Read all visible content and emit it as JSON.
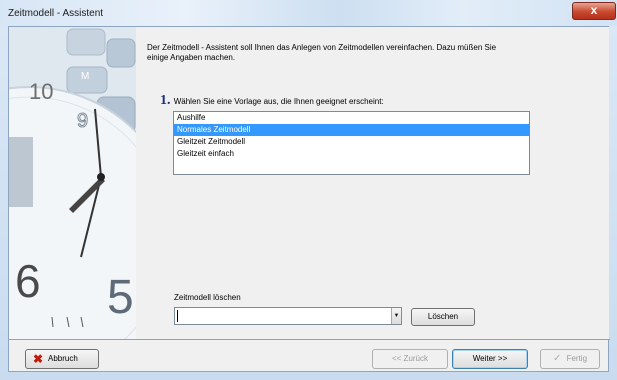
{
  "window": {
    "title": "Zeitmodell - Assistent",
    "close_glyph": "x"
  },
  "content": {
    "intro": "Der Zeitmodell - Assistent soll Ihnen das Anlegen von Zeitmodellen vereinfachen. Dazu müßen Sie einige Angaben machen.",
    "step_number": "1.",
    "step_text": "Wählen Sie eine Vorlage aus, die Ihnen geeignet erscheint:",
    "templates": [
      {
        "label": "Aushilfe",
        "selected": false
      },
      {
        "label": "Normales Zeitmodell",
        "selected": true
      },
      {
        "label": "Gleitzeit Zeitmodell",
        "selected": false
      },
      {
        "label": "Gleitzeit einfach",
        "selected": false
      }
    ],
    "delete_label": "Zeitmodell löschen",
    "delete_combo_value": "",
    "delete_button": "Löschen"
  },
  "footer": {
    "cancel_label": "Abbruch",
    "back_label": "<< Zurück",
    "next_label": "Weiter >>",
    "finish_label": "Fertig"
  },
  "colors": {
    "selection": "#3399ff",
    "step_number": "#1c2f7a",
    "cancel_icon": "#c21a0e"
  },
  "icons": {
    "side_image": "clock-and-calculator-illustration",
    "cancel": "x-icon",
    "finish": "checkmark-pen-icon",
    "combo": "dropdown-arrow-icon"
  }
}
